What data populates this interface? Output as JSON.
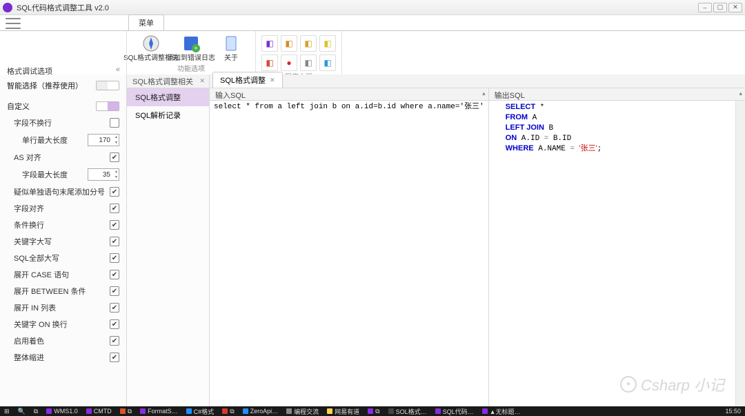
{
  "app": {
    "title": "SQL代码格式调整工具 v2.0"
  },
  "ribbon": {
    "menu_tab": "菜单",
    "group_actions": {
      "label": "功能选项",
      "buttons": [
        {
          "label": "SQL格式调整相关"
        },
        {
          "label": "添加到错误日志"
        },
        {
          "label": "关于"
        }
      ]
    },
    "group_theme": {
      "label": "程序主题"
    }
  },
  "sidebar": {
    "header": "格式调试选项",
    "smart_select": "智能选择（推荐使用）",
    "custom": "自定义",
    "items": [
      {
        "label": "字段不换行",
        "checked": false,
        "indent": 1
      },
      {
        "label": "单行最大长度",
        "value": "170",
        "indent": 2,
        "type": "spin"
      },
      {
        "label": "AS 对齐",
        "checked": true,
        "indent": 1
      },
      {
        "label": "字段最大长度",
        "value": "35",
        "indent": 2,
        "type": "spin"
      },
      {
        "label": "疑似单独语句末尾添加分号",
        "checked": true,
        "indent": 1
      },
      {
        "label": "字段对齐",
        "checked": true,
        "indent": 1
      },
      {
        "label": "条件换行",
        "checked": true,
        "indent": 1
      },
      {
        "label": "关键字大写",
        "checked": true,
        "indent": 1
      },
      {
        "label": "SQL全部大写",
        "checked": true,
        "indent": 1
      },
      {
        "label": "展开 CASE 语句",
        "checked": true,
        "indent": 1
      },
      {
        "label": "展开 BETWEEN 条件",
        "checked": true,
        "indent": 1
      },
      {
        "label": "展开 IN 列表",
        "checked": true,
        "indent": 1
      },
      {
        "label": "关键字 ON 换行",
        "checked": true,
        "indent": 1
      },
      {
        "label": "启用着色",
        "checked": true,
        "indent": 1
      },
      {
        "label": "整体缩进",
        "checked": true,
        "indent": 1
      }
    ]
  },
  "nav": {
    "tab": "SQL格式调整相关",
    "items": [
      {
        "label": "SQL格式调整",
        "selected": true
      },
      {
        "label": "SQL解析记录",
        "selected": false
      }
    ]
  },
  "doc": {
    "tab": "SQL格式调整"
  },
  "panes": {
    "input": {
      "header": "输入SQL",
      "text": "select * from a left join b on a.id=b.id where a.name='张三'"
    },
    "output": {
      "header": "输出SQL",
      "tokens": [
        [
          "kw",
          "SELECT"
        ],
        [
          "txt",
          " *\n"
        ],
        [
          "kw",
          "FROM"
        ],
        [
          "txt",
          " A\n"
        ],
        [
          "kw",
          "LEFT JOIN"
        ],
        [
          "txt",
          " B\n"
        ],
        [
          "kw",
          "ON"
        ],
        [
          "txt",
          " A.ID "
        ],
        [
          "op",
          "="
        ],
        [
          "txt",
          " B.ID\n"
        ],
        [
          "kw",
          "WHERE"
        ],
        [
          "txt",
          " A.NAME "
        ],
        [
          "op",
          "="
        ],
        [
          "txt",
          " "
        ],
        [
          "str",
          "'张三'"
        ],
        [
          "txt",
          ";"
        ]
      ]
    }
  },
  "taskbar": {
    "items": [
      "⊞",
      "🔍",
      "⧉",
      "WMS1.0",
      "CMTD",
      "⧉",
      "FormatS…",
      "C#格式",
      "⧉",
      "ZeroApi…",
      "编程交流",
      "网易有道",
      "⧉",
      "SOL格式…",
      "SQL代码…",
      "▲无标题…"
    ],
    "clock": "15:50"
  },
  "watermark": "Csharp 小记"
}
